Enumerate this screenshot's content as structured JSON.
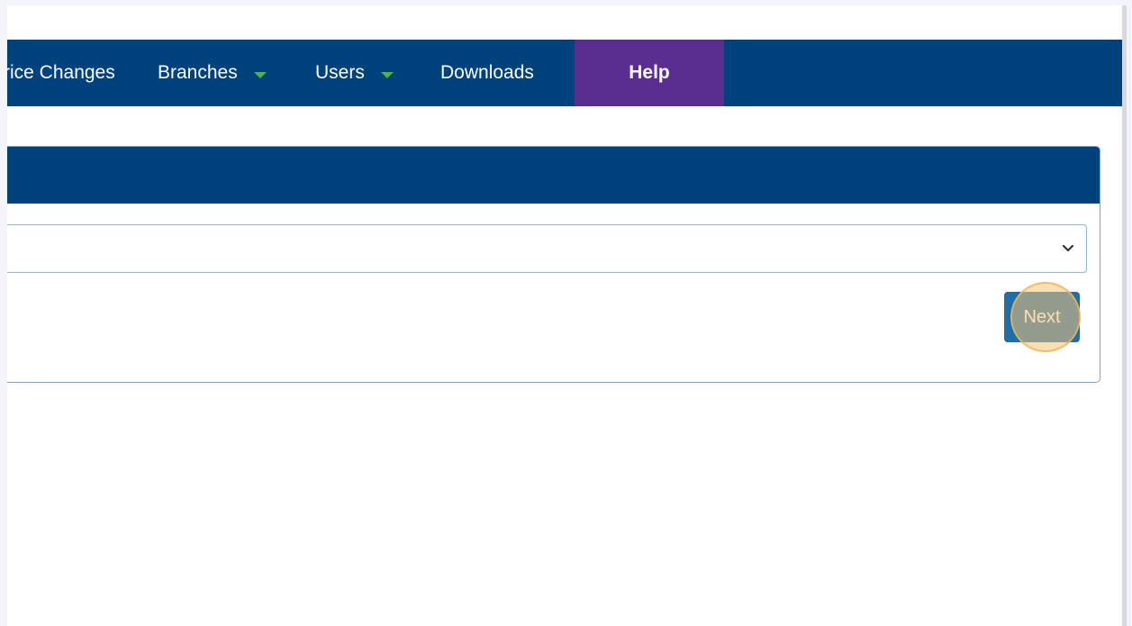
{
  "nav": {
    "price_changes": "rice Changes",
    "branches": "Branches",
    "users": "Users",
    "downloads": "Downloads",
    "help": "Help"
  },
  "form": {
    "select_value": "",
    "next_label": "Next"
  },
  "colors": {
    "navbar": "#00437c",
    "help_bg": "#5a2d91",
    "caret": "#4fb24a",
    "button": "#1f6ea8",
    "click_indicator": "#f4c476"
  },
  "icons": {
    "dropdown": "chevron-down-icon",
    "menu_caret": "caret-down-icon"
  }
}
